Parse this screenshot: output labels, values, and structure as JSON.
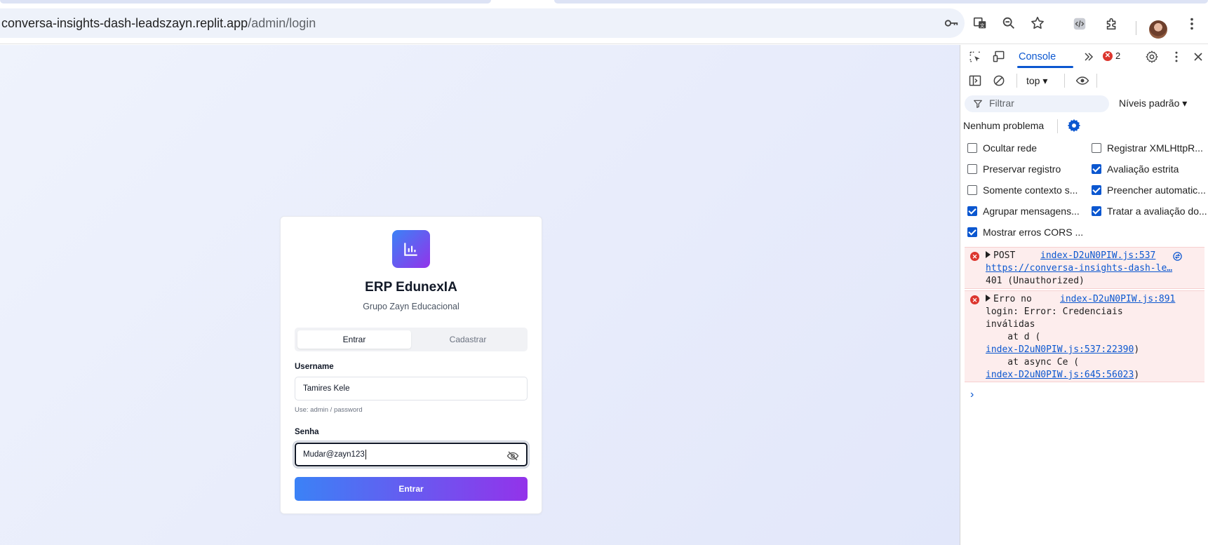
{
  "browser": {
    "url_host": "conversa-insights-dash-leadszayn.replit.app",
    "url_path": "/admin/login"
  },
  "login": {
    "title": "ERP EdunexIA",
    "subtitle": "Grupo Zayn Educacional",
    "tab_login": "Entrar",
    "tab_register": "Cadastrar",
    "username_label": "Username",
    "username_value": "Tamires Kele",
    "username_hint": "Use: admin / password",
    "password_label": "Senha",
    "password_value": "Mudar@zayn123",
    "submit_label": "Entrar"
  },
  "devtools": {
    "active_tab": "Console",
    "error_count": "2",
    "context": "top",
    "filter_placeholder": "Filtrar",
    "levels": "Níveis padrão",
    "issues": "Nenhum problema",
    "options": [
      {
        "label": "Ocultar rede",
        "checked": false
      },
      {
        "label": "Registrar XMLHttpR...",
        "checked": false
      },
      {
        "label": "Preservar registro",
        "checked": false
      },
      {
        "label": "Avaliação estrita",
        "checked": true
      },
      {
        "label": "Somente contexto s...",
        "checked": false
      },
      {
        "label": "Preencher automatic...",
        "checked": true
      },
      {
        "label": "Agrupar mensagens...",
        "checked": true
      },
      {
        "label": "Tratar a avaliação do...",
        "checked": true
      },
      {
        "label": "Mostrar erros CORS ...",
        "checked": true
      }
    ],
    "messages": [
      {
        "method": "POST",
        "source": "index-D2uN0PIW.js:537",
        "url": "https://conversa-insights-dash-le…",
        "status": "401 (Unauthorized)"
      },
      {
        "head": "Erro no",
        "source": "index-D2uN0PIW.js:891",
        "l1": "login: Error: Credenciais",
        "l2": "inválidas",
        "l3": "    at d (",
        "l4_link": "index-D2uN0PIW.js:537:22390",
        "l4_tail": ")",
        "l5": "    at async Ce (",
        "l6_link": "index-D2uN0PIW.js:645:56023",
        "l6_tail": ")"
      }
    ]
  },
  "colors": {
    "accent_start": "#3b82f6",
    "accent_end": "#9333ea",
    "devtools_blue": "#0b57d0",
    "error_red": "#dc362e"
  }
}
